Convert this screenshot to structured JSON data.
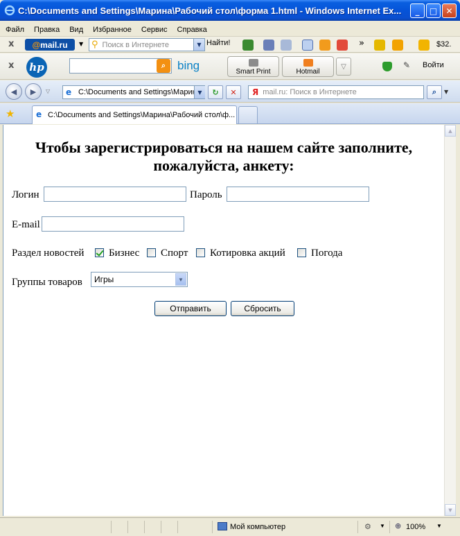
{
  "window": {
    "title": "C:\\Documents and Settings\\Марина\\Рабочий стол\\форма 1.html - Windows Internet Ex...",
    "min_symbol": "_",
    "max_symbol": "□",
    "close_symbol": "✕"
  },
  "menu": [
    "Файл",
    "Правка",
    "Вид",
    "Избранное",
    "Сервис",
    "Справка"
  ],
  "toolbar1": {
    "close_symbol": "x",
    "brand_at": "@",
    "brand_name": "mail.ru",
    "search_placeholder": "Поиск в Интернете",
    "find_label": "Найти!",
    "more_symbol": "»",
    "weather_text": "$32."
  },
  "toolbar2": {
    "close_symbol": "x",
    "hp_logo": "hp",
    "search_icon": "⌕",
    "bing_label": "bing",
    "smart_print_label": "Smart Print",
    "hotmail_label": "Hotmail",
    "login_label": "Войти"
  },
  "addressbar": {
    "back_symbol": "◀",
    "forward_symbol": "▶",
    "url": "C:\\Documents and Settings\\Марина",
    "refresh_symbol": "↻",
    "stop_symbol": "✕",
    "search_logo": "Я",
    "search_placeholder": "mail.ru: Поиск в Интернете",
    "search_btn_symbol": "⌕"
  },
  "tabs": {
    "favorites_symbol": "★",
    "active_tab": "C:\\Documents and Settings\\Марина\\Рабочий стол\\ф..."
  },
  "form": {
    "heading": "Чтобы зарегистрироваться на нашем сайте заполните, пожалуйста, анкету:",
    "login_label": "Логин",
    "login_value": "",
    "password_label": "Пароль",
    "password_value": "",
    "email_label": "E-mail",
    "email_value": "",
    "news_label": "Раздел новостей",
    "news_options": [
      {
        "label": "Бизнес",
        "checked": true
      },
      {
        "label": "Спорт",
        "checked": false
      },
      {
        "label": "Котировка акций",
        "checked": false
      },
      {
        "label": "Погода",
        "checked": false
      }
    ],
    "groups_label": "Группы товаров",
    "groups_selected": "Игры",
    "submit_label": "Отправить",
    "reset_label": "Сбросить"
  },
  "status": {
    "zone": "Мой компьютер",
    "zoom": "100%"
  },
  "colors": {
    "titlebar": "#0553d8",
    "mailru": "#0d4fa6",
    "bing": "#0c82c6",
    "checkmark": "#21a121"
  }
}
